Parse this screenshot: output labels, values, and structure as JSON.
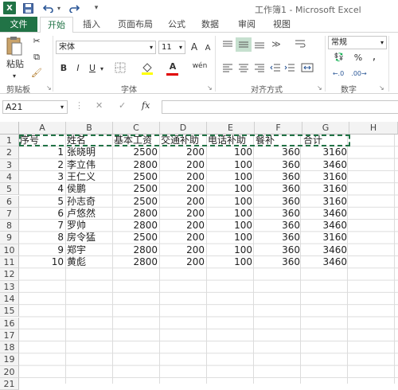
{
  "app": {
    "logo": "X",
    "window_title": "工作簿1 - Microsoft Excel"
  },
  "tabs": [
    "文件",
    "开始",
    "插入",
    "页面布局",
    "公式",
    "数据",
    "审阅",
    "视图"
  ],
  "ribbon": {
    "clipboard": {
      "paste_label": "粘贴",
      "group_label": "剪贴板"
    },
    "font": {
      "font_name": "宋体",
      "font_size": "11",
      "bold": "B",
      "italic": "I",
      "underline": "U",
      "grow": "A",
      "shrink": "A",
      "font_color_letter": "A",
      "wen": "wén",
      "group_label": "字体"
    },
    "alignment": {
      "group_label": "对齐方式"
    },
    "number": {
      "format": "常规",
      "percent": "%",
      "comma": ",",
      "group_label": "数字"
    }
  },
  "formula_bar": {
    "name_box": "A21",
    "fx": "fx",
    "formula": ""
  },
  "columns": [
    "A",
    "B",
    "C",
    "D",
    "E",
    "F",
    "G",
    "H"
  ],
  "rows": [
    "1",
    "2",
    "3",
    "4",
    "5",
    "6",
    "7",
    "8",
    "9",
    "10",
    "11",
    "12",
    "13",
    "14",
    "15",
    "16",
    "17",
    "18",
    "19",
    "20",
    "21"
  ],
  "sheet": {
    "header": [
      "序号",
      "姓名",
      "基本工资",
      "交通补助",
      "电话补助",
      "餐补",
      "合计"
    ],
    "data": [
      [
        "1",
        "张晓明",
        "2500",
        "200",
        "100",
        "360",
        "3160"
      ],
      [
        "2",
        "李立伟",
        "2800",
        "200",
        "100",
        "360",
        "3460"
      ],
      [
        "3",
        "王仁义",
        "2500",
        "200",
        "100",
        "360",
        "3160"
      ],
      [
        "4",
        "侯鹏",
        "2500",
        "200",
        "100",
        "360",
        "3160"
      ],
      [
        "5",
        "孙志奇",
        "2500",
        "200",
        "100",
        "360",
        "3160"
      ],
      [
        "6",
        "卢悠然",
        "2800",
        "200",
        "100",
        "360",
        "3460"
      ],
      [
        "7",
        "罗帅",
        "2800",
        "200",
        "100",
        "360",
        "3460"
      ],
      [
        "8",
        "房令猛",
        "2500",
        "200",
        "100",
        "360",
        "3160"
      ],
      [
        "9",
        "郑宇",
        "2800",
        "200",
        "100",
        "360",
        "3460"
      ],
      [
        "10",
        "黄彪",
        "2800",
        "200",
        "100",
        "360",
        "3460"
      ]
    ]
  },
  "colors": {
    "accent": "#217346",
    "marquee": "#217346"
  }
}
